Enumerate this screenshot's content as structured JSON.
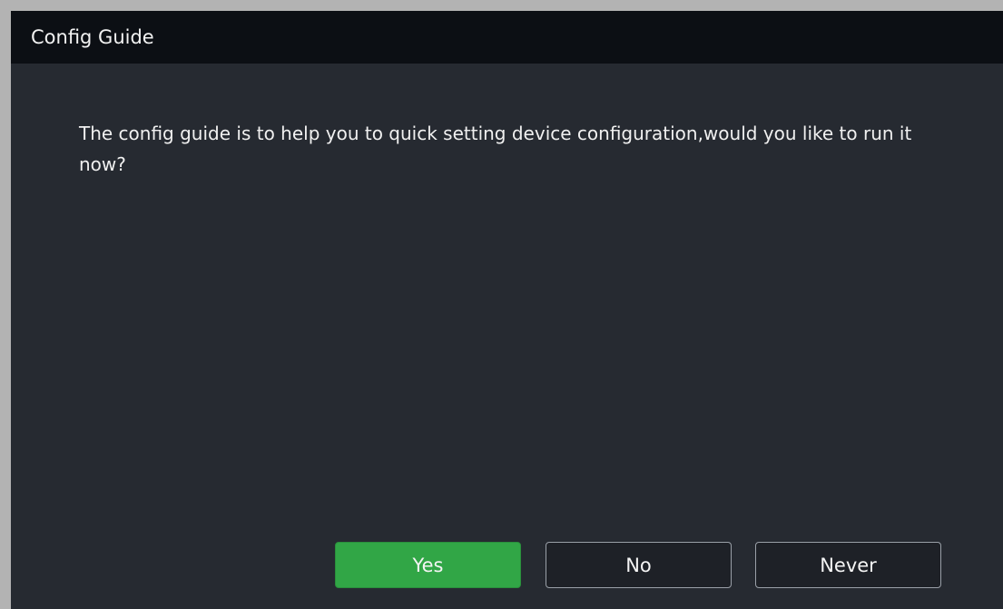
{
  "dialog": {
    "title": "Config Guide",
    "message": "The config guide is to help you to quick setting device configuration,would you like to run it now?",
    "buttons": {
      "yes": "Yes",
      "no": "No",
      "never": "Never"
    }
  },
  "colors": {
    "background": "#262a31",
    "titlebar": "#0c0f14",
    "primary_button": "#31a646",
    "secondary_button": "#1e2127",
    "text": "#f0f0f0"
  }
}
